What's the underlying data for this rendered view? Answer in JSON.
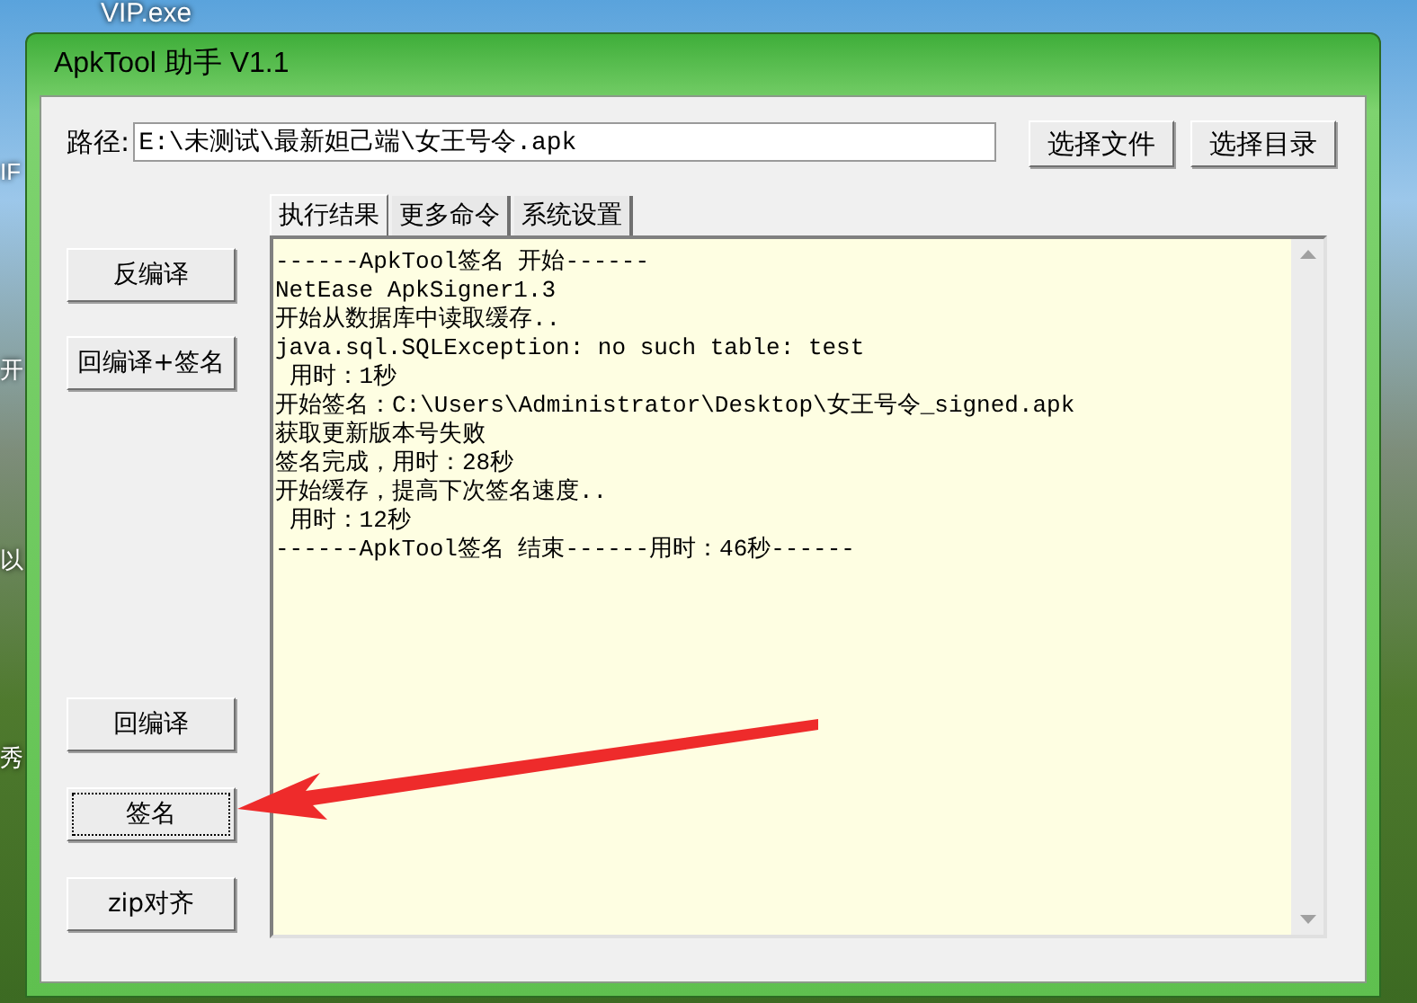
{
  "desktop": {
    "icons": [
      {
        "label": "VIP.exe"
      },
      {
        "label": "IF"
      },
      {
        "label": "开"
      },
      {
        "label": "以"
      },
      {
        "label": "秀"
      }
    ]
  },
  "window": {
    "title": "ApkTool 助手 V1.1"
  },
  "path": {
    "label": "路径:",
    "value": "E:\\未测试\\最新妲己端\\女王号令.apk"
  },
  "path_buttons": [
    "选择文件",
    "选择目录"
  ],
  "tabs": [
    {
      "label": "执行结果",
      "selected": true
    },
    {
      "label": "更多命令",
      "selected": false
    },
    {
      "label": "系统设置",
      "selected": false
    }
  ],
  "side_buttons": [
    {
      "label": "反编译",
      "focused": false
    },
    {
      "label": "回编译+签名",
      "focused": false
    },
    {
      "label": "回编译",
      "focused": false
    },
    {
      "label": "签名",
      "focused": true
    },
    {
      "label": "zip对齐",
      "focused": false
    }
  ],
  "log": [
    "------ApkTool签名 开始------",
    "NetEase ApkSigner1.3",
    "开始从数据库中读取缓存..",
    "java.sql.SQLException: no such table: test",
    " 用时：1秒",
    "开始签名：C:\\Users\\Administrator\\Desktop\\女王号令_signed.apk",
    "获取更新版本号失败",
    "签名完成，用时：28秒",
    "开始缓存，提高下次签名速度..",
    " 用时：12秒",
    "------ApkTool签名 结束------用时：46秒------"
  ]
}
